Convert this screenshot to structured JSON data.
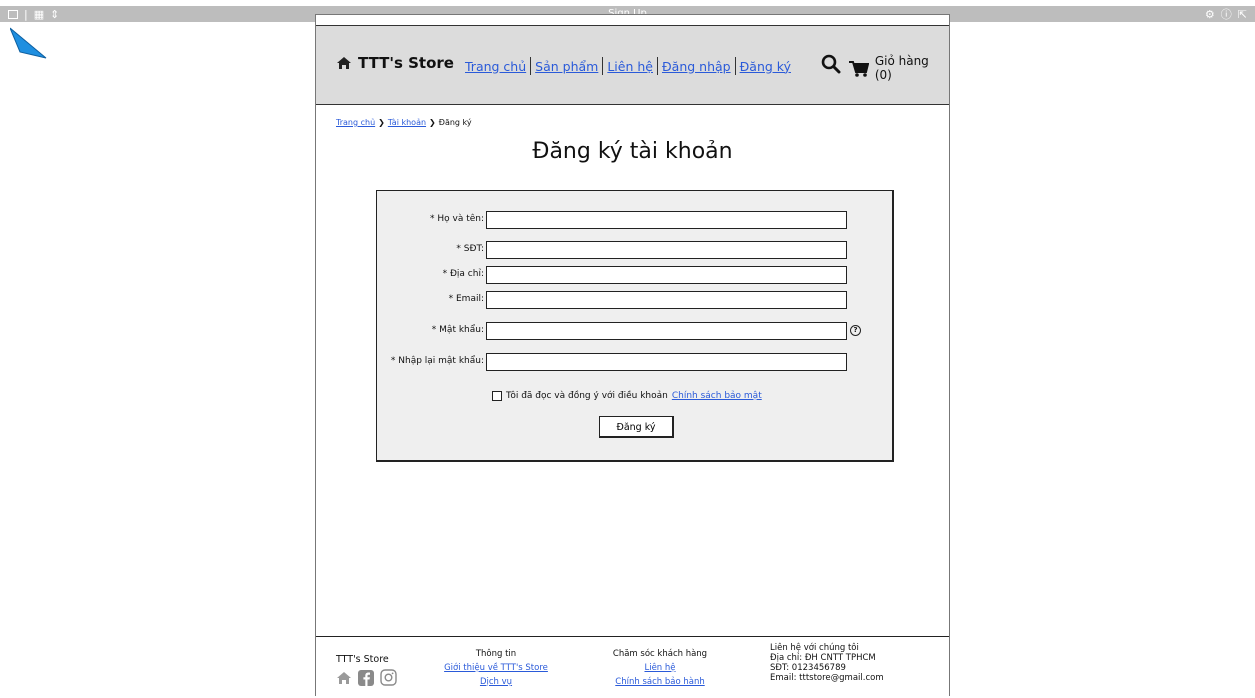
{
  "window": {
    "title": "Sign Up"
  },
  "header": {
    "brand": "TTT's Store",
    "nav": [
      "Trang chủ",
      "Sản phẩm",
      "Liên hệ",
      "Đăng nhập",
      "Đăng ký"
    ],
    "cart_label": "Giỏ hàng (0)"
  },
  "breadcrumb": {
    "items": [
      "Trang chủ",
      "Tài khoản"
    ],
    "current": "Đăng ký"
  },
  "page_title": "Đăng ký tài khoản",
  "form": {
    "fields": [
      {
        "label": "* Họ và tên:",
        "value": ""
      },
      {
        "label": "* SĐT:",
        "value": ""
      },
      {
        "label": "* Địa chỉ:",
        "value": ""
      },
      {
        "label": "* Email:",
        "value": ""
      },
      {
        "label": "* Mật khẩu:",
        "value": ""
      },
      {
        "label": "* Nhập lại mật khẩu:",
        "value": ""
      }
    ],
    "agree_text": "Tôi đã đọc và đồng ý với điều khoản",
    "agree_link": "Chính sách bảo mật",
    "submit_label": "Đăng ký"
  },
  "footer": {
    "brand": "TTT's Store",
    "info": {
      "heading": "Thông tin",
      "links": [
        "Giới thiệu về TTT's Store",
        "Dịch vụ"
      ]
    },
    "care": {
      "heading": "Chăm sóc khách hàng",
      "links": [
        "Liên hệ",
        "Chính sách bảo hành"
      ]
    },
    "contact": {
      "heading": "Liên hệ với chúng tôi",
      "address": "Địa chỉ: ĐH CNTT TPHCM",
      "phone": "SĐT: 0123456789",
      "email": "Email: tttstore@gmail.com"
    }
  },
  "colors": {
    "link": "#2a5ad9",
    "header_bg": "#dcdcdc",
    "form_bg": "#efefef",
    "cursor": "#1f8fe0"
  }
}
